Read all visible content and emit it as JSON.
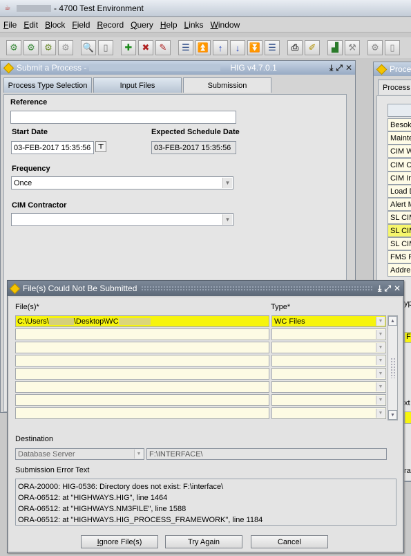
{
  "app": {
    "title": "- 4700 Test Environment"
  },
  "menu": [
    {
      "pre": "",
      "ul": "F",
      "post": "ile"
    },
    {
      "pre": "",
      "ul": "E",
      "post": "dit"
    },
    {
      "pre": "",
      "ul": "B",
      "post": "lock"
    },
    {
      "pre": "",
      "ul": "F",
      "post": "ield"
    },
    {
      "pre": "",
      "ul": "R",
      "post": "ecord"
    },
    {
      "pre": "",
      "ul": "Q",
      "post": "uery"
    },
    {
      "pre": "",
      "ul": "H",
      "post": "elp"
    },
    {
      "pre": "",
      "ul": "L",
      "post": "inks"
    },
    {
      "pre": "",
      "ul": "W",
      "post": "indow"
    }
  ],
  "submit_window": {
    "title": "Submit a Process -",
    "version": "HIG v4.7.0.1",
    "tabs": [
      "Process Type Selection",
      "Input Files",
      "Submission"
    ],
    "reference_label": "Reference",
    "reference_value": "",
    "start_date_label": "Start Date",
    "start_date_value": "03-FEB-2017 15:35:56",
    "expected_label": "Expected Schedule Date",
    "expected_value": "03-FEB-2017 15:35:56",
    "frequency_label": "Frequency",
    "frequency_value": "Once",
    "contractor_label": "CIM Contractor",
    "contractor_value": ""
  },
  "right_window": {
    "title": "Proce",
    "tab": "Process",
    "items": [
      "Besoke",
      "Mainte",
      "CIM W",
      "CIM Co",
      "CIM Inv",
      "Load D",
      "Alert M",
      "SL CIM",
      "SL CIM",
      "SL CIM",
      "FMS F",
      "Addre"
    ],
    "highlight_index": 8,
    "fragments": {
      "typ": "yp",
      "fil": "Fil",
      "ext": "xt",
      "ra": "rat"
    }
  },
  "dialog": {
    "title": "File(s) Could Not Be Submitted",
    "files_header": "File(s)*",
    "type_header": "Type*",
    "rows": [
      {
        "file": "C:\\Users\\",
        "file_mid": "\\Desktop\\WC",
        "type": "WC Files"
      },
      {
        "file": "",
        "file_mid": "",
        "type": ""
      },
      {
        "file": "",
        "file_mid": "",
        "type": ""
      },
      {
        "file": "",
        "file_mid": "",
        "type": ""
      },
      {
        "file": "",
        "file_mid": "",
        "type": ""
      },
      {
        "file": "",
        "file_mid": "",
        "type": ""
      },
      {
        "file": "",
        "file_mid": "",
        "type": ""
      },
      {
        "file": "",
        "file_mid": "",
        "type": ""
      }
    ],
    "destination_label": "Destination",
    "destination_value": "Database Server",
    "destination_path": "F:\\INTERFACE\\",
    "error_label": "Submission Error Text",
    "error_lines": [
      "ORA-20000: HIG-0536: Directory does not exist: F:\\interface\\",
      "ORA-06512: at \"HIGHWAYS.HIG\", line 1464",
      "ORA-06512: at \"HIGHWAYS.NM3FILE\", line 1588",
      "ORA-06512: at \"HIGHWAYS.HIG_PROCESS_FRAMEWORK\", line 1184"
    ],
    "buttons": {
      "ignore_ul": "I",
      "ignore_rest": "gnore File(s)",
      "try_pre": "Try A",
      "try_ul": "g",
      "try_post": "ain",
      "cancel": "Cancel"
    }
  },
  "colors": {
    "highlight": "#f6f40d",
    "row_bg": "#fdfbe4",
    "accent": "#f5c400"
  }
}
